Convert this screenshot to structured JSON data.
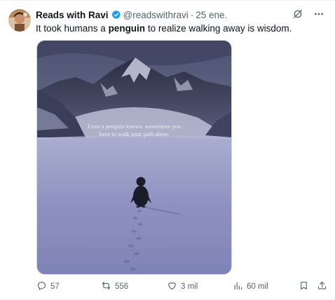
{
  "author": {
    "name": "Reads with Ravi",
    "handle": "@readswithravi",
    "separator": "·",
    "date": "25 ene."
  },
  "tweet": {
    "text_before": "It took humans a ",
    "text_bold": "penguin",
    "text_after": " to realize walking away is wisdom."
  },
  "media": {
    "quote_line1": "Even a penguin knows: sometimes you",
    "quote_line2": "have to walk your path alone."
  },
  "actions": {
    "replies": "57",
    "reposts": "556",
    "likes": "3 mil",
    "views": "60 mil"
  },
  "icons": {
    "verified": "verified-badge-icon",
    "grok": "grok-icon",
    "more": "more-icon",
    "reply": "reply-icon",
    "repost": "repost-icon",
    "like": "heart-icon",
    "views": "views-icon",
    "bookmark": "bookmark-icon",
    "share": "share-icon"
  },
  "colors": {
    "verified_blue": "#1d9bf0",
    "secondary_text": "#536471",
    "primary_text": "#0f1419"
  }
}
